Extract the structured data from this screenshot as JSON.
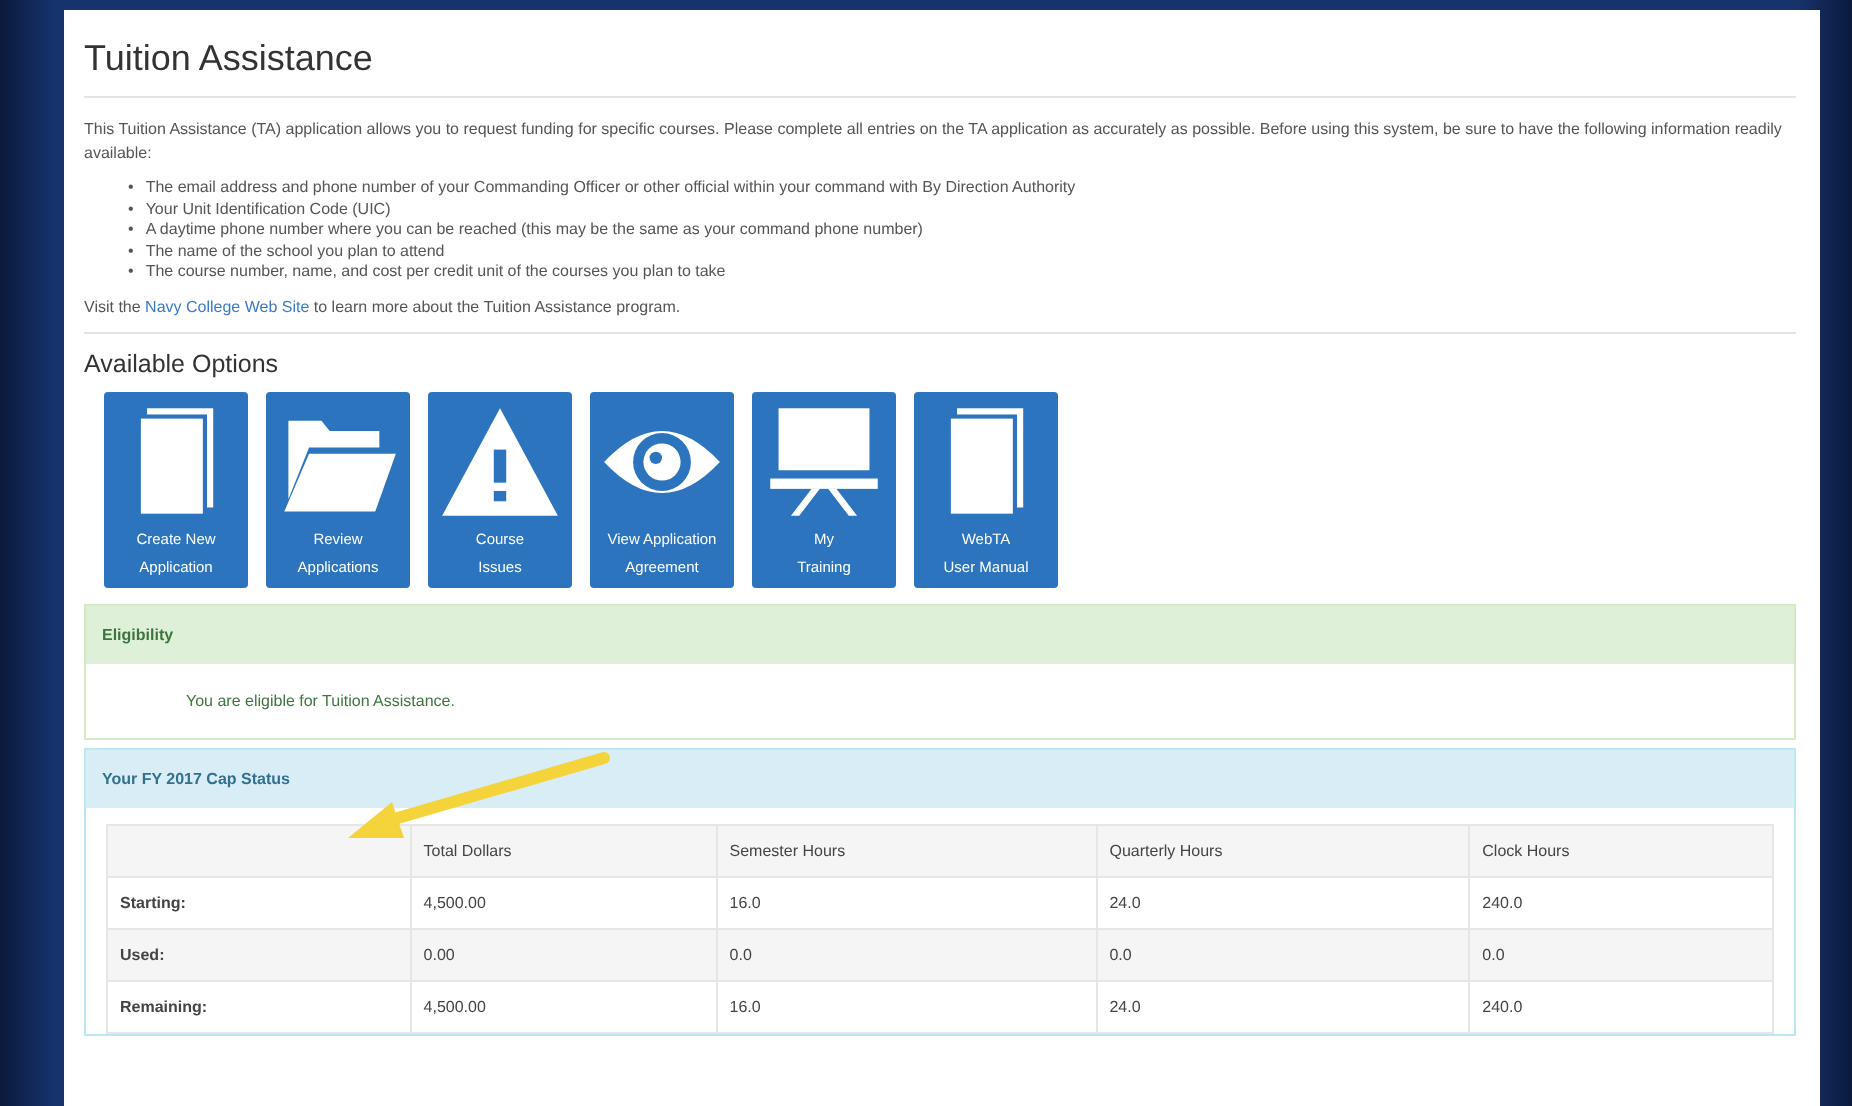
{
  "title": "Tuition Assistance",
  "intro": "This Tuition Assistance (TA) application allows you to request funding for specific courses. Please complete all entries on the TA application as accurately as possible. Before using this system, be sure to have the following information readily available:",
  "requirements": [
    {
      "marker": "•",
      "text": "The email address and phone number of your Commanding Officer or other official within your command with By Direction Authority"
    },
    {
      "marker": "•",
      "text": "Your Unit Identification Code (UIC)"
    },
    {
      "marker": "•",
      "text": "A daytime phone number where you can be reached (this may be the same as your command phone number)"
    },
    {
      "marker": "•",
      "text": "The name of the school you plan to attend"
    },
    {
      "marker": "•",
      "text": "The course number, name, and cost per credit unit of the courses you plan to take"
    }
  ],
  "visit": {
    "before": "Visit the",
    "link": "Navy College Web Site",
    "after": "to learn more about the Tuition Assistance program."
  },
  "options_heading": "Available Options",
  "options": [
    {
      "kind": "book",
      "lines": [
        "Create New",
        "Application"
      ]
    },
    {
      "kind": "folder",
      "lines": [
        "Review",
        "Applications"
      ]
    },
    {
      "kind": "warning",
      "lines": [
        "Course",
        "Issues"
      ]
    },
    {
      "kind": "eye",
      "lines": [
        "View Application",
        "Agreement"
      ]
    },
    {
      "kind": "desk",
      "lines": [
        "My",
        "Training"
      ]
    },
    {
      "kind": "book",
      "lines": [
        "WebTA",
        "User Manual"
      ]
    }
  ],
  "eligibility": {
    "heading": "Eligibility",
    "message": "You are eligible for Tuition Assistance."
  },
  "cap_status": {
    "heading": "Your FY 2017 Cap Status",
    "columns": [
      "Total Dollars",
      "Semester Hours",
      "Quarterly Hours",
      "Clock Hours"
    ],
    "rows": [
      {
        "label": "Starting:",
        "cells": [
          "4,500.00",
          "16.0",
          "24.0",
          "240.0"
        ]
      },
      {
        "label": "Used:",
        "cells": [
          "0.00",
          "0.0",
          "0.0",
          "0.0"
        ]
      },
      {
        "label": "Remaining:",
        "cells": [
          "4,500.00",
          "16.0",
          "24.0",
          "240.0"
        ]
      }
    ]
  }
}
